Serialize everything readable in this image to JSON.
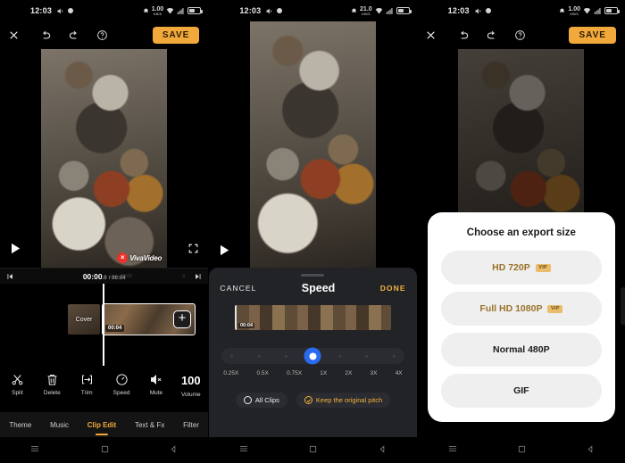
{
  "app": {
    "name": "VivaVideo",
    "watermark": "VivaVideo"
  },
  "panels": [
    {
      "id": "editor",
      "statusbar": {
        "time": "12:03",
        "net_speed_value": "1.00",
        "net_speed_unit": "KB/S",
        "icons": [
          "silent-icon",
          "camera-icon",
          "alarm-icon",
          "wifi-icon",
          "signal-icon",
          "battery-icon"
        ]
      },
      "header": {
        "close_label": "×",
        "undo": "undo-icon",
        "redo": "redo-icon",
        "help": "?",
        "save_label": "SAVE"
      },
      "preview": {
        "play": "play-icon",
        "fullscreen": "fullscreen-icon",
        "watermark": "VivaVideo",
        "watermark_close": "×"
      },
      "timeline": {
        "prev_label": "skip-previous-icon",
        "next_label": "skip-next-icon",
        "current_time": "00:00",
        "current_frac": ".0",
        "total_time": "/ 00:04",
        "ticks": [
          "00:02",
          "·",
          "0"
        ],
        "cover_label": "Cover",
        "clip_duration": "00:04",
        "add_label": "+"
      },
      "tools": [
        {
          "name": "split",
          "label": "Split"
        },
        {
          "name": "delete",
          "label": "Delete"
        },
        {
          "name": "trim",
          "label": "Trim"
        },
        {
          "name": "speed",
          "label": "Speed"
        },
        {
          "name": "mute",
          "label": "Mute"
        },
        {
          "name": "volume",
          "label": "Volume",
          "value": "100"
        }
      ],
      "tabs": [
        {
          "label": "Theme",
          "active": false
        },
        {
          "label": "Music",
          "active": false
        },
        {
          "label": "Clip Edit",
          "active": true
        },
        {
          "label": "Text & Fx",
          "active": false
        },
        {
          "label": "Filter",
          "active": false
        }
      ]
    },
    {
      "id": "speed-sheet",
      "statusbar": {
        "time": "12:03",
        "net_speed_value": "21.0",
        "net_speed_unit": "KB/S"
      },
      "preview": {
        "play": "play-icon"
      },
      "sheet": {
        "cancel_label": "CANCEL",
        "title": "Speed",
        "done_label": "DONE",
        "clip_duration": "00:04",
        "slider_labels": [
          "0.25X",
          "0.5X",
          "0.75X",
          "1X",
          "2X",
          "3X",
          "4X"
        ],
        "selected_speed": "1X",
        "all_clips_label": "All Clips",
        "all_clips_checked": false,
        "keep_pitch_label": "Keep the original pitch",
        "keep_pitch_checked": true
      }
    },
    {
      "id": "export",
      "statusbar": {
        "time": "12:03",
        "net_speed_value": "1.00",
        "net_speed_unit": "KB/S"
      },
      "header": {
        "close_label": "×",
        "save_label": "SAVE"
      },
      "dialog": {
        "title": "Choose an export size",
        "options": [
          {
            "label": "HD 720P",
            "vip": true,
            "vip_badge": "VIP"
          },
          {
            "label": "Full HD 1080P",
            "vip": true,
            "vip_badge": "VIP"
          },
          {
            "label": "Normal 480P",
            "vip": false
          },
          {
            "label": "GIF",
            "vip": false
          }
        ]
      }
    }
  ],
  "navbar": {
    "menu": "menu-icon",
    "home": "home-icon",
    "back": "back-icon"
  },
  "colors": {
    "accent": "#f2a93b",
    "vip_gold": "#e9bd6b",
    "slider_blue": "#2a6af0",
    "sheet_bg": "#222327"
  }
}
